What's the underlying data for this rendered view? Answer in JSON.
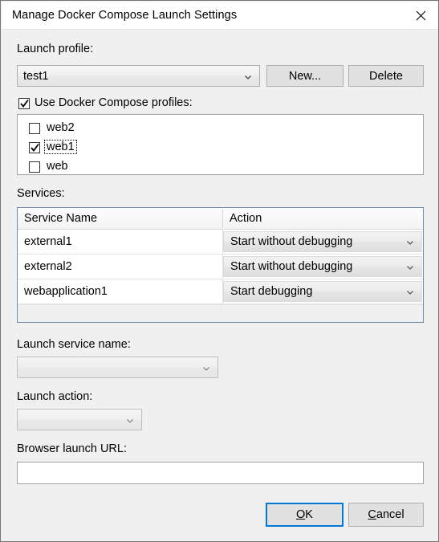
{
  "window": {
    "title": "Manage Docker Compose Launch Settings",
    "close_icon": "close-icon"
  },
  "launch_profile": {
    "label": "Launch profile:",
    "selected": "test1",
    "new_button": "New...",
    "delete_button": "Delete"
  },
  "profiles": {
    "use_checkbox_label": "Use Docker Compose profiles:",
    "use_checkbox_checked": true,
    "items": [
      {
        "label": "web2",
        "checked": false,
        "focused": false
      },
      {
        "label": "web1",
        "checked": true,
        "focused": true
      },
      {
        "label": "web",
        "checked": false,
        "focused": false
      }
    ]
  },
  "services": {
    "label": "Services:",
    "columns": [
      "Service Name",
      "Action"
    ],
    "rows": [
      {
        "name": "external1",
        "action": "Start without debugging"
      },
      {
        "name": "external2",
        "action": "Start without debugging"
      },
      {
        "name": "webapplication1",
        "action": "Start debugging"
      }
    ]
  },
  "launch_service_name": {
    "label": "Launch service name:",
    "value": "",
    "disabled": true
  },
  "launch_action": {
    "label": "Launch action:",
    "value": "",
    "disabled": true
  },
  "browser_launch_url": {
    "label": "Browser launch URL:",
    "value": "",
    "placeholder": ""
  },
  "footer": {
    "ok_label": "OK",
    "ok_accel": "O",
    "cancel_label": "Cancel",
    "cancel_accel": "C"
  },
  "colors": {
    "dialog_background": "#f0f0f0",
    "titlebar_background": "#ffffff",
    "accent_focus": "#0078d7",
    "grid_border": "#6d8aa8",
    "button_face": "#e1e1e1"
  }
}
